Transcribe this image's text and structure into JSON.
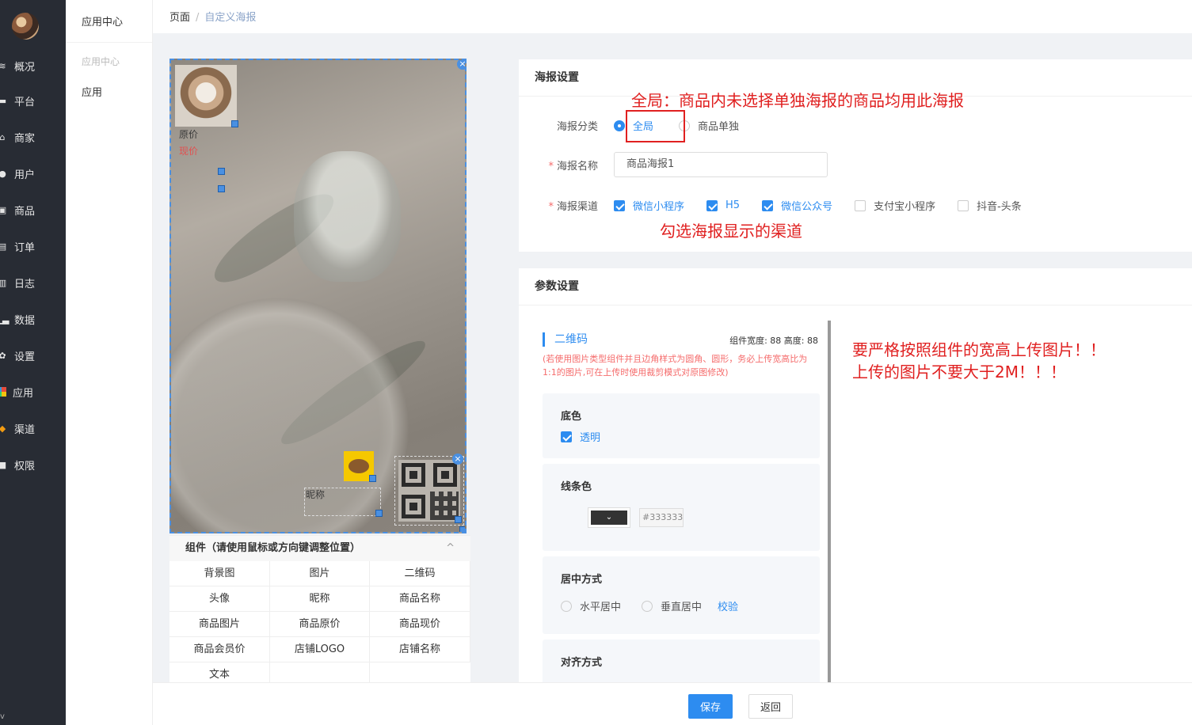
{
  "sidebar": {
    "items": [
      {
        "label": "概况",
        "icon": "chart-icon"
      },
      {
        "label": "平台",
        "icon": "monitor-icon"
      },
      {
        "label": "商家",
        "icon": "store-icon"
      },
      {
        "label": "用户",
        "icon": "user-icon"
      },
      {
        "label": "商品",
        "icon": "goods-icon"
      },
      {
        "label": "订单",
        "icon": "order-icon"
      },
      {
        "label": "日志",
        "icon": "log-icon"
      },
      {
        "label": "数据",
        "icon": "bar-chart-icon"
      },
      {
        "label": "设置",
        "icon": "gear-icon"
      },
      {
        "label": "应用",
        "icon": "grid-icon"
      },
      {
        "label": "渠道",
        "icon": "cube-icon"
      },
      {
        "label": "权限",
        "icon": "lock-icon"
      }
    ],
    "version": "v"
  },
  "submenu": {
    "title": "应用中心",
    "group": "应用中心",
    "item": "应用"
  },
  "breadcrumb": {
    "root": "页面",
    "sep": "/",
    "current": "自定义海报"
  },
  "poster": {
    "original_price": "原价",
    "current_price": "现价",
    "nickname": "昵称",
    "close": "×"
  },
  "components": {
    "header": "组件（请使用鼠标或方向键调整位置）",
    "collapse": "^",
    "items": [
      "背景图",
      "图片",
      "二维码",
      "头像",
      "昵称",
      "商品名称",
      "商品图片",
      "商品原价",
      "商品现价",
      "商品会员价",
      "店铺LOGO",
      "店铺名称",
      "文本",
      ""
    ]
  },
  "poster_settings": {
    "title": "海报设置",
    "category_label": "海报分类",
    "category_options": [
      "全局",
      "商品单独"
    ],
    "name_label": "海报名称",
    "name_value": "商品海报1",
    "channel_label": "海报渠道",
    "channels": [
      {
        "label": "微信小程序",
        "checked": true
      },
      {
        "label": "H5",
        "checked": true
      },
      {
        "label": "微信公众号",
        "checked": true
      },
      {
        "label": "支付宝小程序",
        "checked": false
      },
      {
        "label": "抖音-头条",
        "checked": false
      }
    ]
  },
  "annotations": {
    "global": "全局：商品内未选择单独海报的商品均用此海报",
    "channel": "勾选海报显示的渠道",
    "upload_line1": "要严格按照组件的宽高上传图片！！",
    "upload_line2": "上传的图片不要大于2M！！！"
  },
  "params": {
    "title": "参数设置",
    "component_name": "二维码",
    "size_info": "组件宽度: 88 高度: 88",
    "hint": "(若使用图片类型组件并且边角样式为圆角、圆形，务必上传宽高比为1:1的图片,可在上传时使用裁剪模式对原图修改)",
    "bg_title": "底色",
    "transparent": "透明",
    "line_color_title": "线条色",
    "line_color_hex": "#333333",
    "line_color": "#333333",
    "center_title": "居中方式",
    "center_options": [
      "水平居中",
      "垂直居中"
    ],
    "verify": "校验",
    "align_title": "对齐方式"
  },
  "footer": {
    "save": "保存",
    "back": "返回"
  },
  "colors": {
    "primary": "#2d8cf0",
    "annotation": "#e02020",
    "sidebar": "#282c34"
  }
}
